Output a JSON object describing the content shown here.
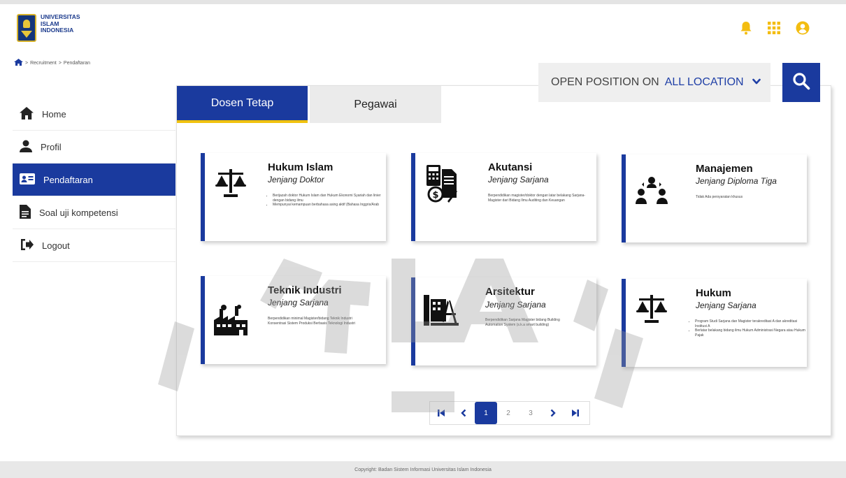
{
  "logo": {
    "line1": "UNIVERSITAS",
    "line2": "ISLAM",
    "line3": "INDONESIA"
  },
  "breadcrumb": {
    "sep1": ">",
    "item1": "Recruitment",
    "sep2": ">",
    "item2": "Pendaftaran"
  },
  "search": {
    "prefix": "OPEN POSITION ON",
    "location": "ALL LOCATION"
  },
  "sidebar": {
    "items": [
      {
        "label": "Home",
        "icon": "home-icon"
      },
      {
        "label": "Profil",
        "icon": "user-icon"
      },
      {
        "label": "Pendaftaran",
        "icon": "id-card-icon",
        "active": true
      },
      {
        "label": "Soal uji kompetensi",
        "icon": "document-icon"
      },
      {
        "label": "Logout",
        "icon": "logout-icon"
      }
    ]
  },
  "tabs": {
    "dosen": "Dosen Tetap",
    "pegawai": "Pegawai"
  },
  "cards": [
    {
      "title": "Hukum Islam",
      "level": "Jenjang Doktor",
      "bullets": [
        "Berijazah doktor Hukum Islam dan Hukum Ekonomi Syariah dan linier dengan bidang ilmu",
        "Mempunyai kemampuan berbahasa asing aktif (Bahasa Inggris/Arab"
      ]
    },
    {
      "title": "Akutansi",
      "level": "Jenjang Sarjana",
      "text": "Berpendidikan magister/doktor dengan latar belakang Sarjana-Magister dari Bidang Ilmu Auditing dan Keuangan"
    },
    {
      "title": "Manajemen",
      "level": "Jenjang Diploma Tiga",
      "text": "Tidak Ada persyaratan khusus"
    },
    {
      "title": "Teknik Industri",
      "level": "Jenjang Sarjana",
      "text": "Berpendidikan minimal Magister/bidang Teknik Industri Konsentrasi Sistem Produksi Berbasis Teknologi Industri"
    },
    {
      "title": "Arsitektur",
      "level": "Jenjang Sarjana",
      "text": "Berpendidikan Sarjana Magister bidang Building Automation System (s.k.a smart building)"
    },
    {
      "title": "Hukum",
      "level": "Jenjang Sarjana",
      "bullets": [
        "Program Studi Sarjana dan Magister terakreditasi A dan akreditasi Institusi A",
        "Berlatar belakang bidang ilmu Hukum Administrasi Negara atau Hukum Pajak"
      ]
    }
  ],
  "pagination": {
    "pages": [
      "1",
      "2",
      "3"
    ],
    "current": "1"
  },
  "footer": {
    "text": "Copyright: Badan Sistem Informasi Universitas Islam Indonesia"
  },
  "colors": {
    "primary": "#1a3a9e",
    "accent": "#f0c20f"
  }
}
